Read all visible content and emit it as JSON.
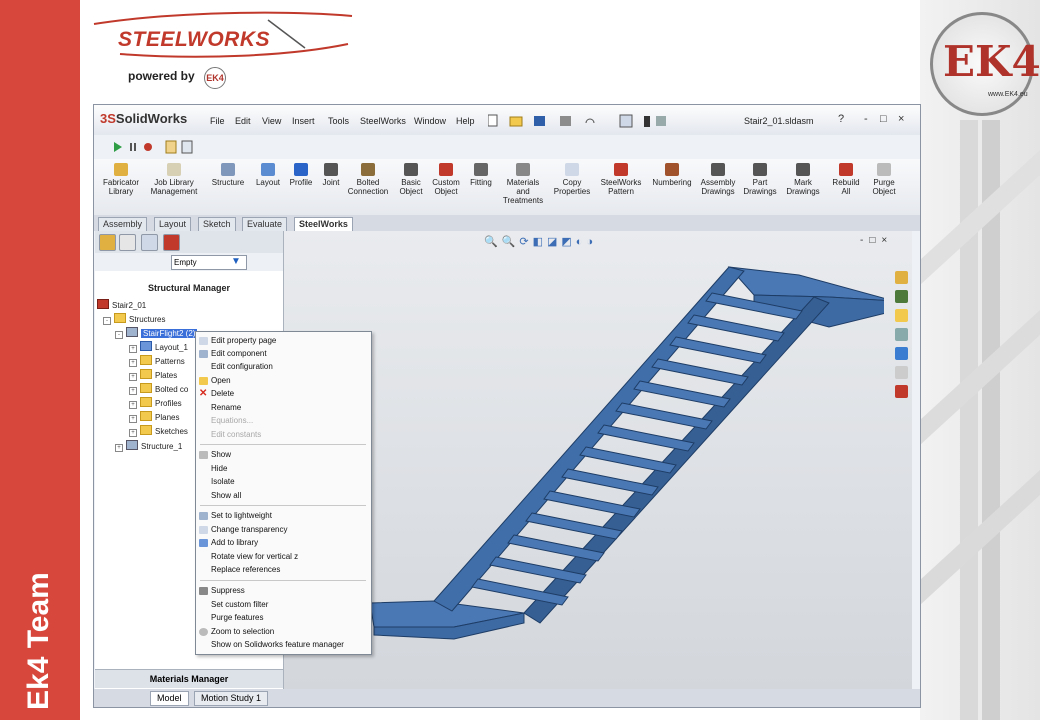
{
  "brand": {
    "logo_text": "STEELWORKS",
    "powered_by": "powered by",
    "ek4_small": "EK4",
    "ek4_big": "EK4",
    "ek4_url": "www.EK4.eu",
    "team_label": "Ek4 Team",
    "red": "#d7473b"
  },
  "app": {
    "logo_prefix": "3S",
    "logo": "SolidWorks",
    "menu": [
      "File",
      "Edit",
      "View",
      "Insert",
      "Tools",
      "SteelWorks",
      "Window",
      "Help"
    ],
    "filename": "Stair2_01.sldasm",
    "help_glyph": "?",
    "window_controls": [
      "-",
      "□",
      "×"
    ]
  },
  "ribbon": {
    "buttons": [
      "Fabricator Library",
      "Job Library Management",
      "Structure",
      "Layout",
      "Profile",
      "Joint",
      "Bolted Connection",
      "Basic Object",
      "Custom Object",
      "Fitting",
      "Materials and Treatments",
      "Copy Properties",
      "SteelWorks Pattern",
      "Numbering",
      "Assembly Drawings",
      "Part Drawings",
      "Mark Drawings",
      "Rebuild All",
      "Purge Object"
    ]
  },
  "command_tabs": [
    "Assembly",
    "Layout",
    "Sketch",
    "Evaluate",
    "SteelWorks"
  ],
  "active_command_tab": "SteelWorks",
  "panel": {
    "filter_value": "Empty",
    "header": "Structural Manager",
    "tree": {
      "root": "Stair2_01",
      "structures": "Structures",
      "selected": "StairFlight2 (2)",
      "children": [
        "Layout_1",
        "Patterns",
        "Plates",
        "Bolted co",
        "Profiles",
        "Planes",
        "Sketches"
      ],
      "sibling": "Structure_1"
    },
    "footer": "Materials Manager"
  },
  "bottom_tabs": [
    "Model",
    "Motion Study 1"
  ],
  "context_menu": {
    "group1": [
      {
        "label": "Edit property page",
        "enabled": true
      },
      {
        "label": "Edit component",
        "enabled": true
      },
      {
        "label": "Edit configuration",
        "enabled": true
      },
      {
        "label": "Open",
        "enabled": true
      },
      {
        "label": "Delete",
        "enabled": true
      },
      {
        "label": "Rename",
        "enabled": true
      },
      {
        "label": "Equations...",
        "enabled": false
      },
      {
        "label": "Edit constants",
        "enabled": false
      }
    ],
    "group2": [
      "Show",
      "Hide",
      "Isolate",
      "Show all"
    ],
    "group3": [
      "Set to lightweight",
      "Change transparency",
      "Add to library",
      "Rotate view for vertical z",
      "Replace references"
    ],
    "group4": [
      "Suppress",
      "Set custom filter",
      "Purge features",
      "Zoom to selection",
      "Show on Solidworks feature manager"
    ]
  },
  "model_color": "#4a78b5"
}
